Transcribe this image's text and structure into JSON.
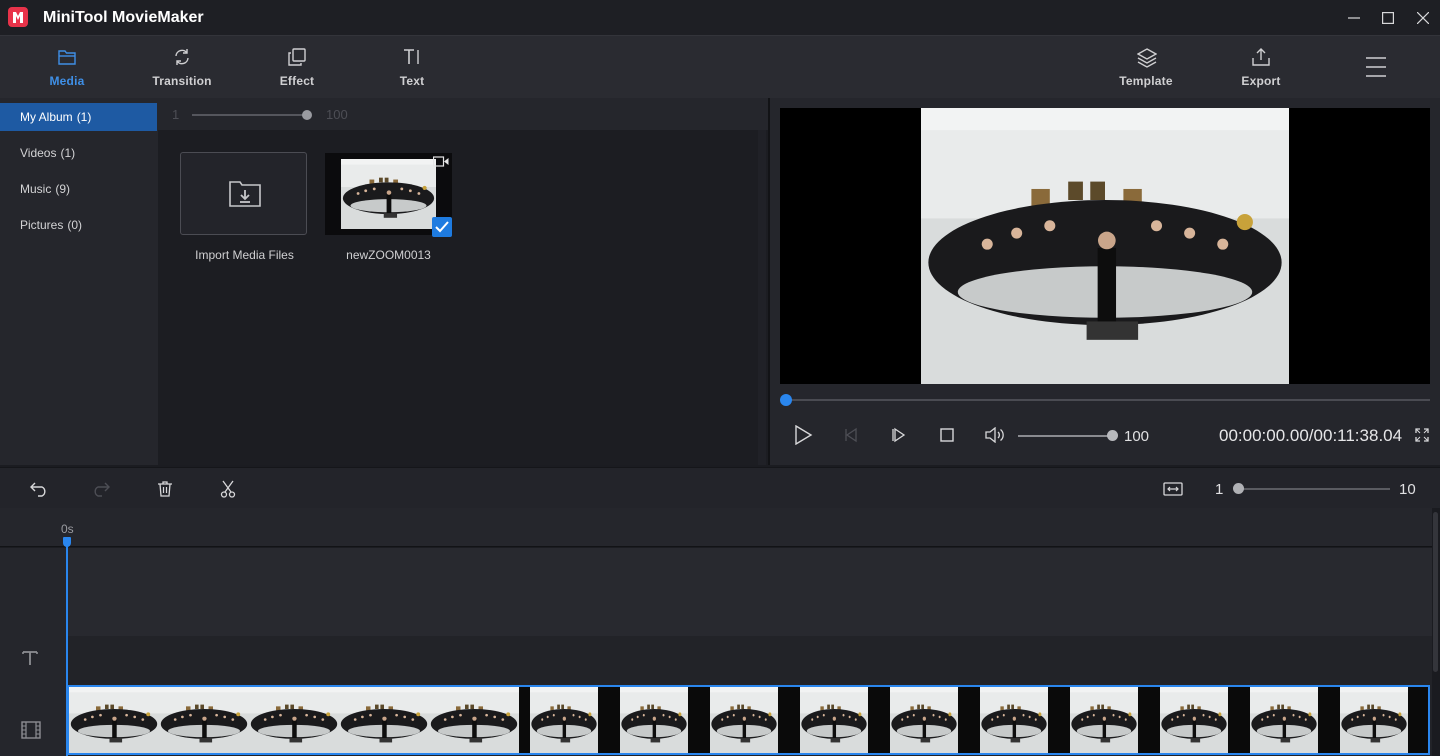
{
  "app": {
    "title": "MiniTool MovieMaker"
  },
  "toolbar": {
    "media": "Media",
    "transition": "Transition",
    "effect": "Effect",
    "text": "Text",
    "template": "Template",
    "export": "Export"
  },
  "sidebar": {
    "items": [
      {
        "label": "My Album",
        "count": "(1)"
      },
      {
        "label": "Videos",
        "count": "(1)"
      },
      {
        "label": "Music",
        "count": "(9)"
      },
      {
        "label": "Pictures",
        "count": "(0)"
      }
    ]
  },
  "media": {
    "thumb_size_min": "1",
    "thumb_size_max": "100",
    "thumb_size_level": 1.0,
    "import_label": "Import Media Files",
    "clips": [
      {
        "name": "newZOOM0013",
        "selected": true
      }
    ]
  },
  "player": {
    "progress": 0.0,
    "volume": "100",
    "volume_level": 1.0,
    "timecode": "00:00:00.00/00:11:38.04"
  },
  "timeline": {
    "zoom_min": "1",
    "zoom_max": "10",
    "zoom_level": 0.0,
    "ruler_start": "0s"
  },
  "colors": {
    "accent": "#2a86ee",
    "active_tab": "#3f8fe6",
    "sidebar_selected": "#1e5aa3",
    "logo": "#e8334a"
  }
}
